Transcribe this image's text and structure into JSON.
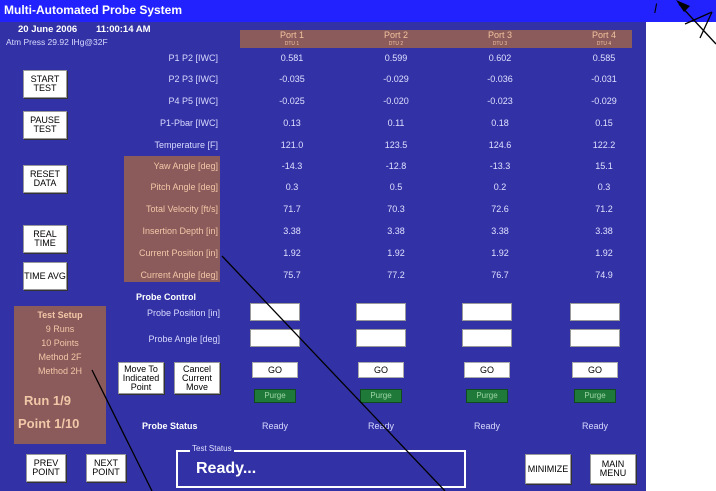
{
  "app": {
    "title": "Multi-Automated Probe System"
  },
  "header": {
    "date": "20 June 2006",
    "time": "11:00:14 AM",
    "atm_press": "Atm Press 29.92  IHg@32F"
  },
  "ports": [
    {
      "name": "Port 1",
      "sub": "DTU 1"
    },
    {
      "name": "Port 2",
      "sub": "DTU 2"
    },
    {
      "name": "Port 3",
      "sub": "DTU 3"
    },
    {
      "name": "Port 4",
      "sub": "DTU 4"
    }
  ],
  "rows": [
    {
      "label": "P1 P2 [IWC]",
      "values": [
        "0.581",
        "0.599",
        "0.602",
        "0.585"
      ]
    },
    {
      "label": "P2 P3 [IWC]",
      "values": [
        "-0.035",
        "-0.029",
        "-0.036",
        "-0.031"
      ]
    },
    {
      "label": "P4 P5 [IWC]",
      "values": [
        "-0.025",
        "-0.020",
        "-0.023",
        "-0.029"
      ]
    },
    {
      "label": "P1-Pbar [IWC]",
      "values": [
        "0.13",
        "0.11",
        "0.18",
        "0.15"
      ]
    },
    {
      "label": "Temperature [F]",
      "values": [
        "121.0",
        "123.5",
        "124.6",
        "122.2"
      ]
    },
    {
      "label": "Yaw Angle [deg]",
      "values": [
        "-14.3",
        "-12.8",
        "-13.3",
        "15.1"
      ]
    },
    {
      "label": "Pitch Angle [deg]",
      "values": [
        "0.3",
        "0.5",
        "0.2",
        "0.3"
      ]
    },
    {
      "label": "Total Velocity [ft/s]",
      "values": [
        "71.7",
        "70.3",
        "72.6",
        "71.2"
      ]
    },
    {
      "label": "Insertion Depth [in]",
      "values": [
        "3.38",
        "3.38",
        "3.38",
        "3.38"
      ]
    },
    {
      "label": "Current Position [in]",
      "values": [
        "1.92",
        "1.92",
        "1.92",
        "1.92"
      ]
    },
    {
      "label": "Current Angle [deg]",
      "values": [
        "75.7",
        "77.2",
        "76.7",
        "74.9"
      ]
    }
  ],
  "side_buttons": {
    "start": "START TEST",
    "pause": "PAUSE TEST",
    "reset": "RESET DATA",
    "real_time": "REAL TIME",
    "time_avg": "TIME AVG"
  },
  "probe_control": {
    "title": "Probe Control",
    "position_label": "Probe Position [in]",
    "angle_label": "Probe Angle [deg]",
    "move_button": "Move To Indicated Point",
    "cancel_button": "Cancel Current Move",
    "go_label": "GO",
    "purge_label": "Purge",
    "status_label": "Probe Status",
    "statuses": [
      "Ready",
      "Ready",
      "Ready",
      "Ready"
    ]
  },
  "test_setup": {
    "title": "Test Setup",
    "runs": "9 Runs",
    "points": "10 Points",
    "method1": "Method 2F",
    "method2": "Method 2H",
    "run": "Run  1/9",
    "point": "Point  1/10"
  },
  "footer": {
    "prev": "PREV POINT",
    "next": "NEXT POINT",
    "status_title": "Test Status",
    "status_text": "Ready...",
    "minimize": "MINIMIZE",
    "main_menu": "MAIN MENU"
  },
  "annotation": {
    "text": "l"
  },
  "colors": {
    "titlebar": "#2222ff",
    "panel": "#3232a6",
    "highlight": "#8b5a5a",
    "purge": "#1f7a3a"
  }
}
